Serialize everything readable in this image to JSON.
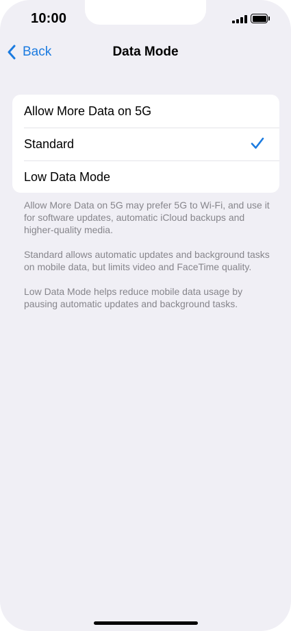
{
  "status_bar": {
    "time": "10:00"
  },
  "nav": {
    "back_label": "Back",
    "title": "Data Mode"
  },
  "options": [
    {
      "label": "Allow More Data on 5G",
      "selected": false
    },
    {
      "label": "Standard",
      "selected": true
    },
    {
      "label": "Low Data Mode",
      "selected": false
    }
  ],
  "descriptions": [
    "Allow More Data on 5G may prefer 5G to Wi-Fi, and use it for software updates, automatic iCloud backups and higher-quality media.",
    "Standard allows automatic updates and background tasks on mobile data, but limits video and FaceTime quality.",
    "Low Data Mode helps reduce mobile data usage by pausing automatic updates and background tasks."
  ],
  "colors": {
    "accent": "#1b7be0",
    "background": "#f0eff5",
    "secondary_text": "#86858b"
  },
  "icons": {
    "back": "chevron-left-icon",
    "selected": "checkmark-icon",
    "signal": "cellular-signal-icon",
    "battery": "battery-icon"
  }
}
